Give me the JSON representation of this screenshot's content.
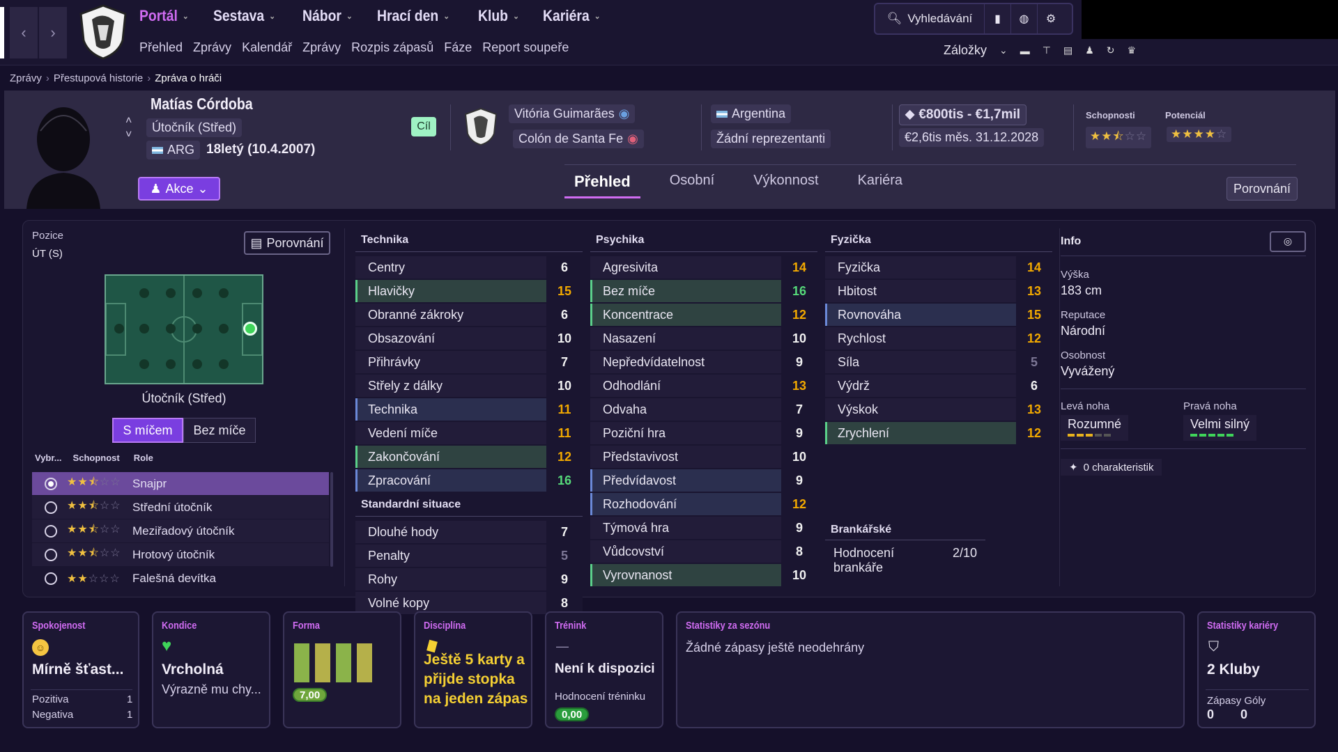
{
  "nav": {
    "menu": [
      {
        "label": "Portál",
        "active": true
      },
      {
        "label": "Sestava"
      },
      {
        "label": "Nábor"
      },
      {
        "label": "Hrací den"
      },
      {
        "label": "Klub"
      },
      {
        "label": "Kariéra"
      }
    ],
    "submenu": [
      "Přehled",
      "Zprávy",
      "Kalendář",
      "Zprávy",
      "Rozpis zápasů",
      "Fáze",
      "Report soupeře"
    ],
    "search_label": "Vyhledávání",
    "bookmarks_label": "Záložky"
  },
  "breadcrumb": [
    "Zprávy",
    "Přestupová historie",
    "Zpráva o hráči"
  ],
  "player": {
    "name": "Matías Córdoba",
    "position": "Útočník (Střed)",
    "nation_code": "ARG",
    "age": "18letý (10.4.2007)",
    "target": "Cíl",
    "club": "Vitória Guimarães",
    "loan_club": "Colón de Santa Fe",
    "nation": "Argentina",
    "caps": "Žádní reprezentanti",
    "value": "€800tis - €1,7mil",
    "wage": "€2,6tis měs. 31.12.2028",
    "ability_label": "Schopnosti",
    "potential_label": "Potenciál",
    "ability_stars": 2.5,
    "potential_stars": 4,
    "action_label": "Akce"
  },
  "tabs": [
    {
      "label": "Přehled",
      "active": true
    },
    {
      "label": "Osobní"
    },
    {
      "label": "Výkonnost"
    },
    {
      "label": "Kariéra"
    }
  ],
  "compare_label": "Porovnání",
  "position_panel": {
    "label": "Pozice",
    "value": "ÚT (S)",
    "compare_label": "Porovnání",
    "pitch_caption": "Útočník (Střed)",
    "seg_with": "S míčem",
    "seg_without": "Bez míče",
    "col_headers": [
      "Vybr...",
      "Schopnost",
      "Role"
    ],
    "roles": [
      {
        "name": "Snajpr",
        "stars": 2.5,
        "selected": true
      },
      {
        "name": "Střední útočník",
        "stars": 2.5
      },
      {
        "name": "Meziřadový útočník",
        "stars": 2.5
      },
      {
        "name": "Hrotový útočník",
        "stars": 2.5
      },
      {
        "name": "Falešná devítka",
        "stars": 2
      }
    ]
  },
  "technika": {
    "title": "Technika",
    "rows": [
      {
        "name": "Centry",
        "value": 6
      },
      {
        "name": "Hlavičky",
        "value": 15,
        "hl": "g"
      },
      {
        "name": "Obranné zákroky",
        "value": 6
      },
      {
        "name": "Obsazování",
        "value": 10
      },
      {
        "name": "Přihrávky",
        "value": 7
      },
      {
        "name": "Střely z dálky",
        "value": 10
      },
      {
        "name": "Technika",
        "value": 11,
        "hl": "b"
      },
      {
        "name": "Vedení míče",
        "value": 11
      },
      {
        "name": "Zakončování",
        "value": 12,
        "hl": "g"
      },
      {
        "name": "Zpracování",
        "value": 16,
        "hl": "b"
      }
    ]
  },
  "standard": {
    "title": "Standardní situace",
    "rows": [
      {
        "name": "Dlouhé hody",
        "value": 7
      },
      {
        "name": "Penalty",
        "value": 5
      },
      {
        "name": "Rohy",
        "value": 9
      },
      {
        "name": "Volné kopy",
        "value": 8
      }
    ]
  },
  "psychika": {
    "title": "Psychika",
    "rows": [
      {
        "name": "Agresivita",
        "value": 14
      },
      {
        "name": "Bez míče",
        "value": 16,
        "hl": "g"
      },
      {
        "name": "Koncentrace",
        "value": 12,
        "hl": "g"
      },
      {
        "name": "Nasazení",
        "value": 10
      },
      {
        "name": "Nepředvídatelnost",
        "value": 9
      },
      {
        "name": "Odhodlání",
        "value": 13
      },
      {
        "name": "Odvaha",
        "value": 7
      },
      {
        "name": "Poziční hra",
        "value": 9
      },
      {
        "name": "Představivost",
        "value": 10
      },
      {
        "name": "Předvídavost",
        "value": 9,
        "hl": "b"
      },
      {
        "name": "Rozhodování",
        "value": 12,
        "hl": "b"
      },
      {
        "name": "Týmová hra",
        "value": 9
      },
      {
        "name": "Vůdcovství",
        "value": 8
      },
      {
        "name": "Vyrovnanost",
        "value": 10,
        "hl": "g"
      }
    ]
  },
  "fyzicka": {
    "title": "Fyzička",
    "rows": [
      {
        "name": "Fyzička",
        "value": 14
      },
      {
        "name": "Hbitost",
        "value": 13
      },
      {
        "name": "Rovnováha",
        "value": 15,
        "hl": "b"
      },
      {
        "name": "Rychlost",
        "value": 12
      },
      {
        "name": "Síla",
        "value": 5
      },
      {
        "name": "Výdrž",
        "value": 6
      },
      {
        "name": "Výskok",
        "value": 13
      },
      {
        "name": "Zrychlení",
        "value": 12,
        "hl": "g"
      }
    ]
  },
  "gk": {
    "title": "Brankářské",
    "text": "Hodnocení brankáře",
    "value": "2/10"
  },
  "info": {
    "title": "Info",
    "height_label": "Výška",
    "height": "183 cm",
    "rep_label": "Reputace",
    "rep": "Národní",
    "pers_label": "Osobnost",
    "pers": "Vyvážený",
    "left_label": "Levá noha",
    "left": "Rozumné",
    "left_level": 0.6,
    "right_label": "Pravá noha",
    "right": "Velmi silný",
    "right_level": 1.0,
    "traits": "0 charakteristik"
  },
  "cards": {
    "spok": {
      "title": "Spokojenost",
      "value": "Mírně šťast...",
      "pos_label": "Pozitiva",
      "pos": "1",
      "neg_label": "Negativa",
      "neg": "1"
    },
    "kond": {
      "title": "Kondice",
      "value": "Vrcholná",
      "sub": "Výrazně mu chy..."
    },
    "forma": {
      "title": "Forma",
      "rating": "7,00",
      "bars": [
        1,
        1,
        1,
        1
      ]
    },
    "disc": {
      "title": "Disciplína",
      "text": "Ještě 5 karty a přijde stopka na jeden zápas"
    },
    "tren": {
      "title": "Trénink",
      "dash": "—",
      "value": "Není k dispozici",
      "sub": "Hodnocení tréninku",
      "rating": "0,00"
    },
    "season": {
      "title": "Statistiky za sezónu",
      "text": "Žádné zápasy ještě neodehrány"
    },
    "career": {
      "title": "Statistiky kariéry",
      "value": "2 Kluby",
      "apps_label": "Zápasy",
      "goals_label": "Góly",
      "apps": "0",
      "goals": "0"
    }
  }
}
